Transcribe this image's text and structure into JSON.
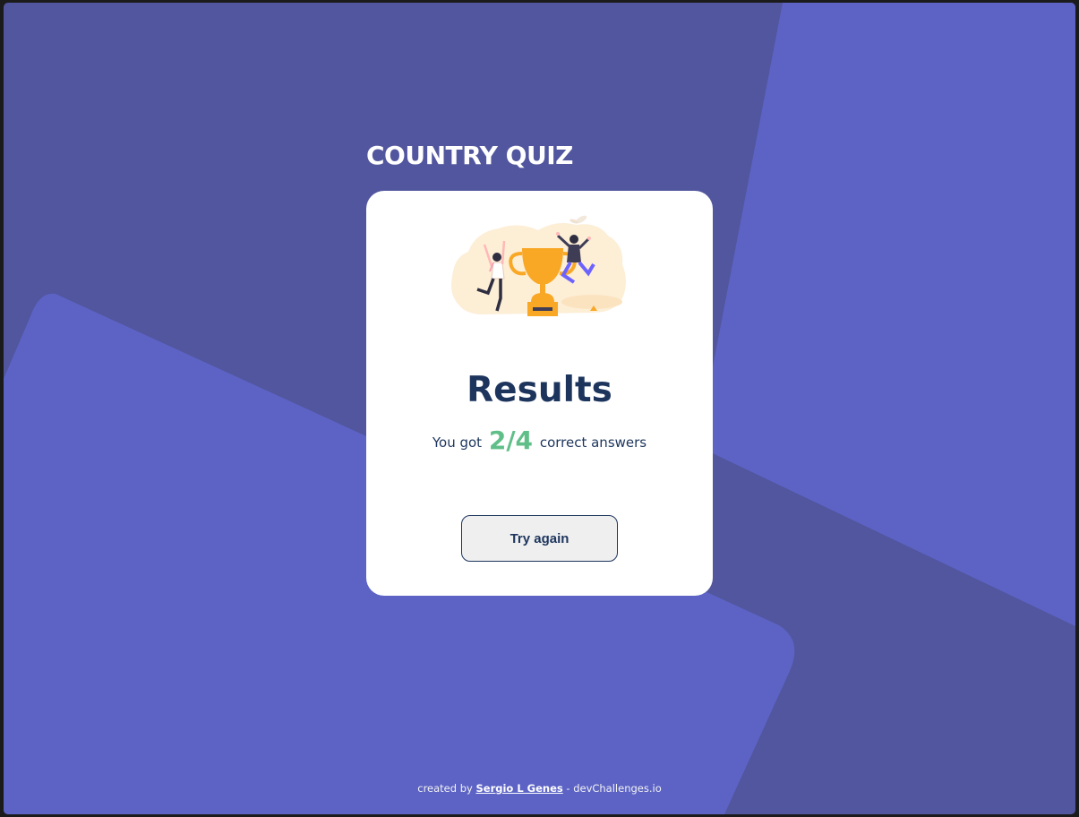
{
  "app": {
    "title": "COUNTRY QUIZ"
  },
  "results": {
    "title": "Results",
    "score_prefix": "You got",
    "score": "2/4",
    "score_suffix": "correct answers",
    "try_again_label": "Try again"
  },
  "footer": {
    "prefix": "created by",
    "author": "Sergio L Genes",
    "separator": " - ",
    "site": "devChallenges.io"
  },
  "colors": {
    "background_dark": "#52569e",
    "background_light": "#5c63c5",
    "title_text": "#ffffff",
    "heading_text": "#1d355d",
    "score_green": "#60bf88",
    "trophy_gold": "#f9a826"
  },
  "icons": {
    "illustration": "winners-trophy-illustration"
  }
}
